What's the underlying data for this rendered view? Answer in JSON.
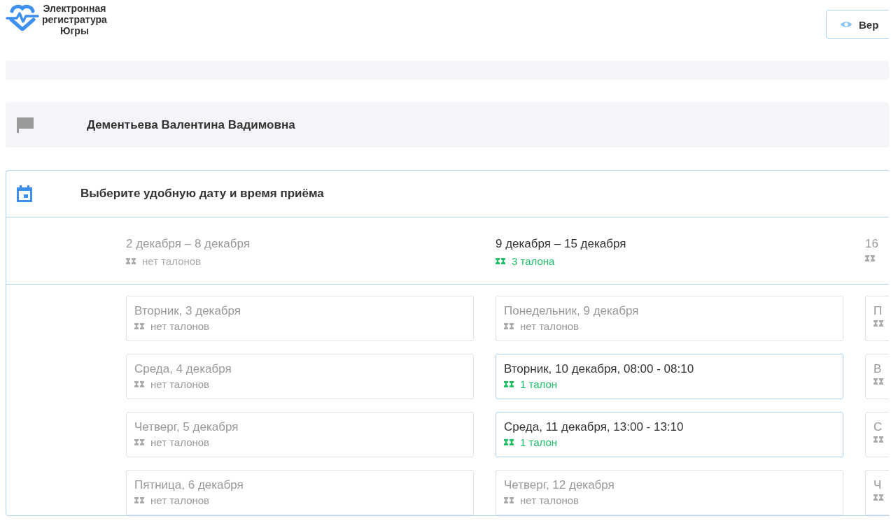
{
  "header": {
    "logo_lines": [
      "Электронная",
      "регистратура",
      "Югры"
    ],
    "button": "Вер"
  },
  "panels": [
    {
      "kind": "partial"
    },
    {
      "kind": "doctor",
      "text": "Дементьева Валентина Вадимовна"
    }
  ],
  "calendar": {
    "title": "Выберите удобную дату и время приёма",
    "weeks": [
      {
        "range": "2 декабря – 8 декабря",
        "tickets": "нет талонов",
        "available": false,
        "days": [
          {
            "title": "Вторник, 3 декабря",
            "tickets": "нет талонов",
            "available": false
          },
          {
            "title": "Среда, 4 декабря",
            "tickets": "нет талонов",
            "available": false
          },
          {
            "title": "Четверг, 5 декабря",
            "tickets": "нет талонов",
            "available": false
          },
          {
            "title": "Пятница, 6 декабря",
            "tickets": "нет талонов",
            "available": false
          }
        ]
      },
      {
        "range": "9 декабря – 15 декабря",
        "tickets": "3 талона",
        "available": true,
        "days": [
          {
            "title": "Понедельник, 9 декабря",
            "tickets": "нет талонов",
            "available": false
          },
          {
            "title": "Вторник, 10 декабря, 08:00 - 08:10",
            "tickets": "1 талон",
            "available": true
          },
          {
            "title": "Среда, 11 декабря, 13:00 - 13:10",
            "tickets": "1 талон",
            "available": true
          },
          {
            "title": "Четверг, 12 декабря",
            "tickets": "нет талонов",
            "available": false
          }
        ]
      },
      {
        "range": "16",
        "available": false,
        "days": [
          {
            "title": "П",
            "available": false
          },
          {
            "title": "В",
            "available": false
          },
          {
            "title": "С",
            "available": false
          },
          {
            "title": "Ч",
            "available": false
          }
        ]
      }
    ]
  }
}
